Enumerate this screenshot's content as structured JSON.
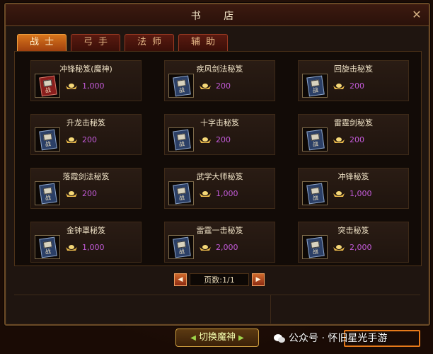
{
  "window": {
    "title": "书 店"
  },
  "tabs": [
    {
      "label": "战士",
      "active": true
    },
    {
      "label": "弓手",
      "active": false
    },
    {
      "label": "法师",
      "active": false
    },
    {
      "label": "辅助",
      "active": false
    }
  ],
  "items": [
    {
      "name": "冲锋秘笈(魔神)",
      "price": "1,000",
      "book_color": "red"
    },
    {
      "name": "疾风剑法秘笈",
      "price": "200",
      "book_color": "blue"
    },
    {
      "name": "回旋击秘笈",
      "price": "200",
      "book_color": "blue"
    },
    {
      "name": "升龙击秘笈",
      "price": "200",
      "book_color": "blue"
    },
    {
      "name": "十字击秘笈",
      "price": "200",
      "book_color": "blue"
    },
    {
      "name": "雷霆剑秘笈",
      "price": "200",
      "book_color": "blue"
    },
    {
      "name": "落霞剑法秘笈",
      "price": "200",
      "book_color": "blue"
    },
    {
      "name": "武学大师秘笈",
      "price": "1,000",
      "book_color": "blue"
    },
    {
      "name": "冲锋秘笈",
      "price": "1,000",
      "book_color": "blue"
    },
    {
      "name": "金钟罩秘笈",
      "price": "1,000",
      "book_color": "blue"
    },
    {
      "name": "雷霆一击秘笈",
      "price": "2,000",
      "book_color": "blue"
    },
    {
      "name": "突击秘笈",
      "price": "2,000",
      "book_color": "blue"
    }
  ],
  "book_glyph": "战",
  "pager": {
    "text": "页数:1/1",
    "prev_icon": "triangle-left-icon",
    "next_icon": "triangle-right-icon"
  },
  "switch_button": {
    "label": "切换魔神"
  },
  "watermark": {
    "text": "公众号 · 怀旧星光手游"
  },
  "colors": {
    "price": "#c35bd9",
    "tab_active": "#d8751c",
    "gold": "#e8b84a"
  }
}
